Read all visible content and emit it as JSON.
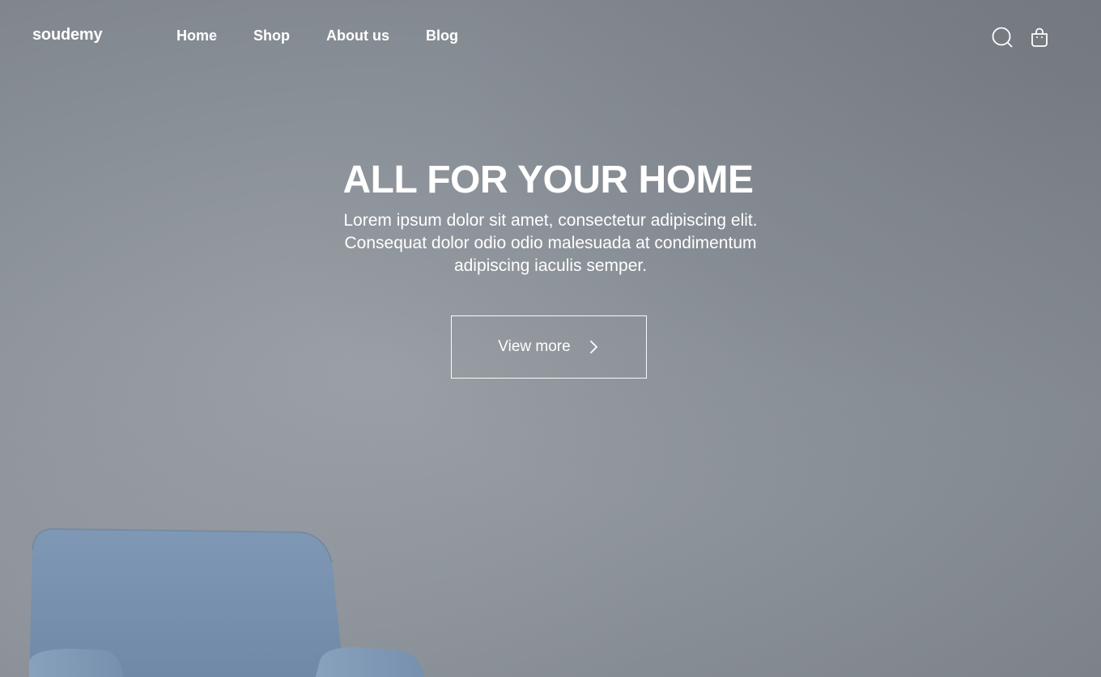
{
  "brand": {
    "logo_text": "soudemy"
  },
  "nav": {
    "items": [
      {
        "label": "Home"
      },
      {
        "label": "Shop"
      },
      {
        "label": "About us"
      },
      {
        "label": "Blog"
      }
    ],
    "icons": [
      "search-icon",
      "shopping-bag-icon"
    ]
  },
  "hero": {
    "title": "ALL FOR YOUR HOME",
    "subtitle": "Lorem ipsum dolor sit amet, consectetur adipiscing elit. Consequat dolor odio odio malesuada at condimentum adipiscing iaculis semper.",
    "cta_label": "View more",
    "cta_icon": "chevron-right-icon"
  },
  "colors": {
    "text": "#ffffff",
    "background": "#8c9299",
    "chair": "#7f99b6"
  }
}
